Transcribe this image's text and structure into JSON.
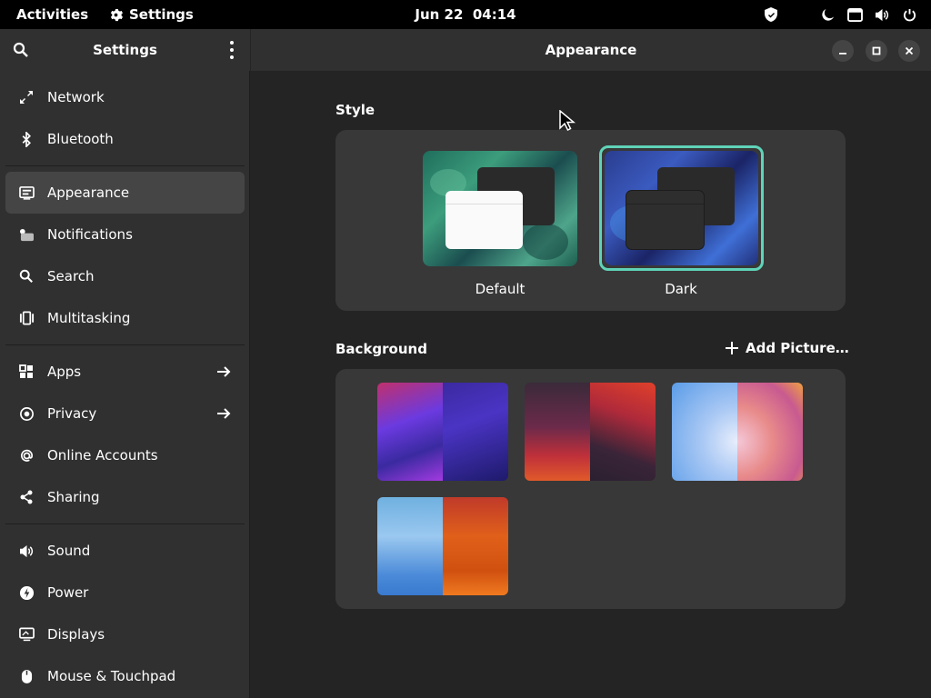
{
  "topbar": {
    "activities": "Activities",
    "app_name": "Settings",
    "clock": "Jun 22  04:14",
    "tray_icons": [
      "shield-icon",
      "night-light-icon",
      "network-icon",
      "volume-icon",
      "power-icon"
    ]
  },
  "sidebar": {
    "title": "Settings",
    "groups": [
      [
        {
          "label": "Network",
          "icon": "network-icon"
        },
        {
          "label": "Bluetooth",
          "icon": "bluetooth-icon"
        }
      ],
      [
        {
          "label": "Appearance",
          "icon": "appearance-icon",
          "active": true
        },
        {
          "label": "Notifications",
          "icon": "notifications-icon"
        },
        {
          "label": "Search",
          "icon": "search-icon"
        },
        {
          "label": "Multitasking",
          "icon": "multitasking-icon"
        }
      ],
      [
        {
          "label": "Apps",
          "icon": "apps-icon",
          "arrow": true
        },
        {
          "label": "Privacy",
          "icon": "privacy-icon",
          "arrow": true
        },
        {
          "label": "Online Accounts",
          "icon": "online-accounts-icon"
        },
        {
          "label": "Sharing",
          "icon": "sharing-icon"
        }
      ],
      [
        {
          "label": "Sound",
          "icon": "sound-icon"
        },
        {
          "label": "Power",
          "icon": "power-icon"
        },
        {
          "label": "Displays",
          "icon": "displays-icon"
        },
        {
          "label": "Mouse & Touchpad",
          "icon": "mouse-icon"
        }
      ]
    ]
  },
  "main": {
    "title": "Appearance",
    "style": {
      "heading": "Style",
      "options": [
        {
          "label": "Default",
          "selected": false
        },
        {
          "label": "Dark",
          "selected": true
        }
      ]
    },
    "background": {
      "heading": "Background",
      "add_label": "Add Picture…"
    }
  },
  "colors": {
    "accent": "#5fd3b8",
    "window_bg": "#242424",
    "sidebar_bg": "#303030",
    "card_bg": "#383838"
  }
}
